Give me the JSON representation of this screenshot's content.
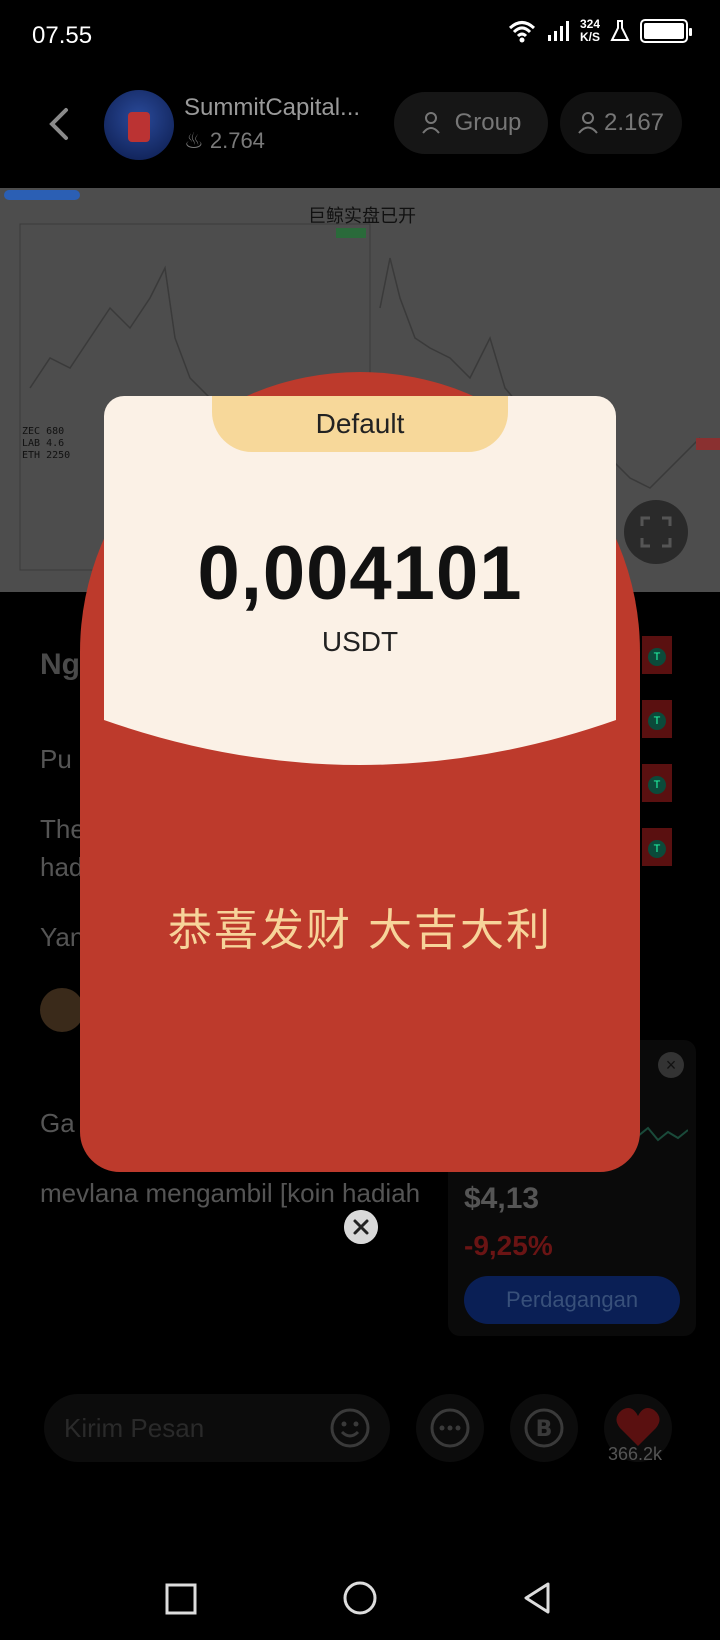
{
  "status_bar": {
    "time": "07.55",
    "net_speed_value": "324",
    "net_speed_unit": "K/S"
  },
  "header": {
    "room_name": "SummitCapital...",
    "likes": "2.764",
    "group_label": "Group",
    "viewers": "2.167"
  },
  "chart": {
    "overlay_text": "巨鲸实盘已开",
    "tickers": [
      "ZEC  680",
      "LAB  4.6",
      "ETH  2250"
    ]
  },
  "background": {
    "line1": "Ng",
    "line2": "Pu",
    "line3a": "The",
    "line3b": "had",
    "line4": "Yan",
    "line5": "Ga",
    "line6": "mevlana mengambil [koin hadiah"
  },
  "trade_widget": {
    "price": "$4,13",
    "change": "-9,25%",
    "trade_button": "Perdagangan",
    "change_color": "#e0283a"
  },
  "input": {
    "placeholder": "Kirim Pesan"
  },
  "likes_total": "366.2k",
  "envelope": {
    "tab_label": "Default",
    "amount": "0,004101",
    "currency": "USDT",
    "blessing": "恭喜发财 大吉大利",
    "red": "#bd3a2c",
    "gold": "#f7d49a"
  }
}
